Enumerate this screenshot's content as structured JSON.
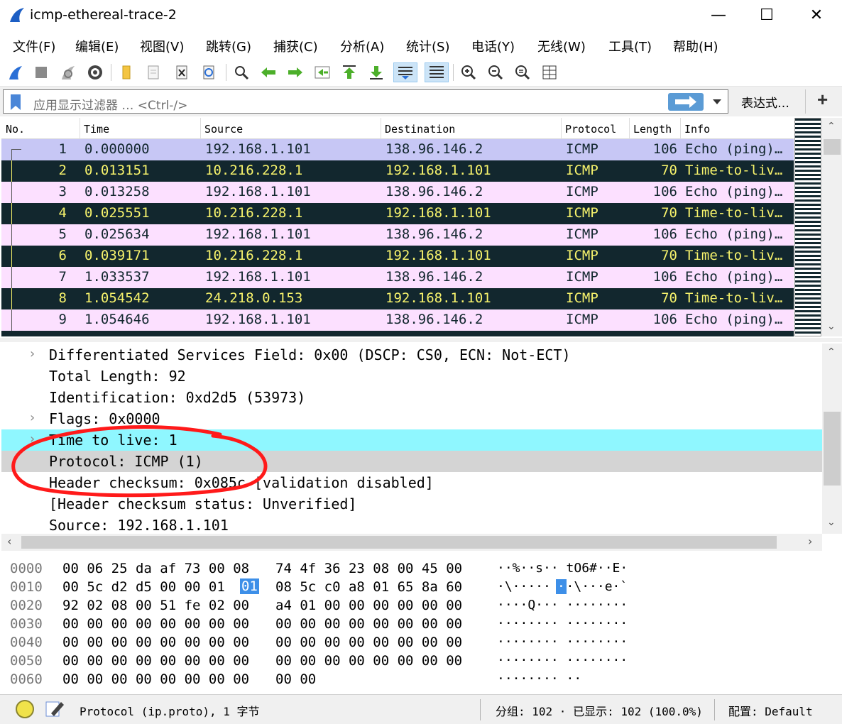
{
  "window": {
    "title": "icmp-ethereal-trace-2",
    "minimize": "—",
    "maximize": "☐",
    "close": "✕"
  },
  "menu": [
    "文件(F)",
    "编辑(E)",
    "视图(V)",
    "跳转(G)",
    "捕获(C)",
    "分析(A)",
    "统计(S)",
    "电话(Y)",
    "无线(W)",
    "工具(T)",
    "帮助(H)"
  ],
  "filter": {
    "placeholder": "应用显示过滤器 … <Ctrl-/>",
    "expression_label": "表达式…",
    "add_label": "+"
  },
  "packet_list": {
    "columns": [
      "No.",
      "Time",
      "Source",
      "Destination",
      "Protocol",
      "Length",
      "Info"
    ],
    "rows": [
      {
        "no": "1",
        "time": "0.000000",
        "src": "192.168.1.101",
        "dst": "138.96.146.2",
        "proto": "ICMP",
        "len": "106",
        "info": "Echo (ping)…",
        "kind": "sel"
      },
      {
        "no": "2",
        "time": "0.013151",
        "src": "10.216.228.1",
        "dst": "192.168.1.101",
        "proto": "ICMP",
        "len": "70",
        "info": "Time-to-liv…",
        "kind": "ttl"
      },
      {
        "no": "3",
        "time": "0.013258",
        "src": "192.168.1.101",
        "dst": "138.96.146.2",
        "proto": "ICMP",
        "len": "106",
        "info": "Echo (ping)…",
        "kind": "req"
      },
      {
        "no": "4",
        "time": "0.025551",
        "src": "10.216.228.1",
        "dst": "192.168.1.101",
        "proto": "ICMP",
        "len": "70",
        "info": "Time-to-liv…",
        "kind": "ttl"
      },
      {
        "no": "5",
        "time": "0.025634",
        "src": "192.168.1.101",
        "dst": "138.96.146.2",
        "proto": "ICMP",
        "len": "106",
        "info": "Echo (ping)…",
        "kind": "req"
      },
      {
        "no": "6",
        "time": "0.039171",
        "src": "10.216.228.1",
        "dst": "192.168.1.101",
        "proto": "ICMP",
        "len": "70",
        "info": "Time-to-liv…",
        "kind": "ttl"
      },
      {
        "no": "7",
        "time": "1.033537",
        "src": "192.168.1.101",
        "dst": "138.96.146.2",
        "proto": "ICMP",
        "len": "106",
        "info": "Echo (ping)…",
        "kind": "req"
      },
      {
        "no": "8",
        "time": "1.054542",
        "src": "24.218.0.153",
        "dst": "192.168.1.101",
        "proto": "ICMP",
        "len": "70",
        "info": "Time-to-liv…",
        "kind": "ttl"
      },
      {
        "no": "9",
        "time": "1.054646",
        "src": "192.168.1.101",
        "dst": "138.96.146.2",
        "proto": "ICMP",
        "len": "106",
        "info": "Echo (ping)…",
        "kind": "req"
      }
    ]
  },
  "details": [
    {
      "text": "Differentiated Services Field: 0x00 (DSCP: CS0, ECN: Not-ECT)",
      "expander": "›",
      "style": "normal"
    },
    {
      "text": "Total Length: 92",
      "expander": "",
      "style": "normal"
    },
    {
      "text": "Identification: 0xd2d5 (53973)",
      "expander": "",
      "style": "normal"
    },
    {
      "text": "Flags: 0x0000",
      "expander": "›",
      "style": "normal"
    },
    {
      "text": "Time to live: 1",
      "expander": "›",
      "style": "cyan"
    },
    {
      "text": "Protocol: ICMP (1)",
      "expander": "",
      "style": "selected"
    },
    {
      "text": "Header checksum: 0x085c [validation disabled]",
      "expander": "",
      "style": "normal"
    },
    {
      "text": "[Header checksum status: Unverified]",
      "expander": "",
      "style": "normal"
    },
    {
      "text": "Source: 192.168.1.101",
      "expander": "",
      "style": "normal"
    }
  ],
  "hex": [
    {
      "offset": "0000",
      "b1": "00 06 25 da af 73 00 08",
      "b2": "74 4f 36 23 08 00 45 00",
      "ascii": "··%··s·· tO6#··E·"
    },
    {
      "offset": "0010",
      "b1": "00 5c d2 d5 00 00 01 ",
      "b2": "08 5c c0 a8 01 65 8a 60",
      "ascii": "·\\·····  ·\\···e·`",
      "hl": "01",
      "hl_ascii": "·"
    },
    {
      "offset": "0020",
      "b1": "92 02 08 00 51 fe 02 00",
      "b2": "a4 01 00 00 00 00 00 00",
      "ascii": "····Q··· ········"
    },
    {
      "offset": "0030",
      "b1": "00 00 00 00 00 00 00 00",
      "b2": "00 00 00 00 00 00 00 00",
      "ascii": "········ ········"
    },
    {
      "offset": "0040",
      "b1": "00 00 00 00 00 00 00 00",
      "b2": "00 00 00 00 00 00 00 00",
      "ascii": "········ ········"
    },
    {
      "offset": "0050",
      "b1": "00 00 00 00 00 00 00 00",
      "b2": "00 00 00 00 00 00 00 00",
      "ascii": "········ ········"
    },
    {
      "offset": "0060",
      "b1": "00 00 00 00 00 00 00 00",
      "b2": "00 00",
      "ascii": "········ ··"
    }
  ],
  "status": {
    "field_info": "Protocol (ip.proto), 1 字节",
    "packets": "分组: 102 · 已显示: 102 (100.0%)",
    "profile": "配置: Default"
  },
  "colors": {
    "request_bg": "#fce0ff",
    "ttl_bg": "#12272e",
    "ttl_fg": "#f7f36c",
    "selected_bg": "#c7c7f5",
    "annotation": "#ff1a1a"
  }
}
